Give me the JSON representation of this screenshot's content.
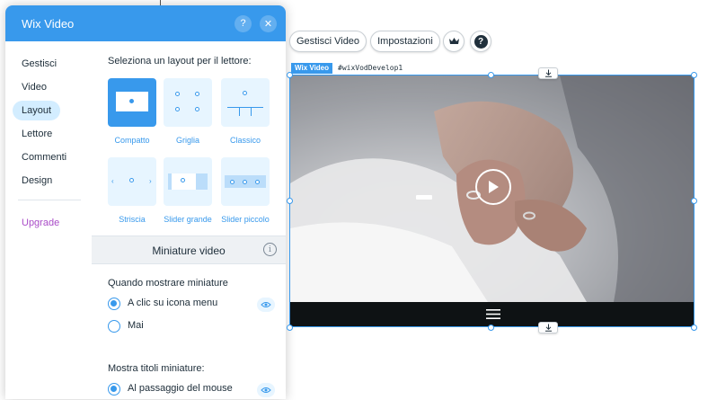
{
  "panel": {
    "title": "Wix Video",
    "help_label": "?",
    "close_label": "✕"
  },
  "sidebar": {
    "items": [
      {
        "label": "Gestisci"
      },
      {
        "label": "Video"
      },
      {
        "label": "Layout",
        "active": true
      },
      {
        "label": "Lettore"
      },
      {
        "label": "Commenti"
      },
      {
        "label": "Design"
      }
    ],
    "upgrade": "Upgrade"
  },
  "layout": {
    "heading": "Seleziona un layout per il lettore:",
    "options": [
      {
        "label": "Compatto",
        "selected": true
      },
      {
        "label": "Griglia"
      },
      {
        "label": "Classico"
      },
      {
        "label": "Striscia"
      },
      {
        "label": "Slider grande"
      },
      {
        "label": "Slider piccolo"
      }
    ]
  },
  "thumbnails": {
    "title": "Miniature video",
    "info_label": "i",
    "when_label": "Quando mostrare miniature",
    "when_options": [
      {
        "label": "A clic su icona menu",
        "checked": true
      },
      {
        "label": "Mai",
        "checked": false
      }
    ],
    "titles_label": "Mostra titoli miniature:",
    "titles_options": [
      {
        "label": "Al passaggio del mouse",
        "checked": true
      }
    ]
  },
  "toolbar": {
    "manage_label": "Gestisci Video",
    "settings_label": "Impostazioni",
    "help_label": "?"
  },
  "widget": {
    "type_tag": "Wix Video",
    "id_tag": "#wixVodDevelop1"
  },
  "colors": {
    "accent": "#3899ec",
    "upgrade": "#aa4dc8",
    "control_bar": "#0e1214"
  }
}
